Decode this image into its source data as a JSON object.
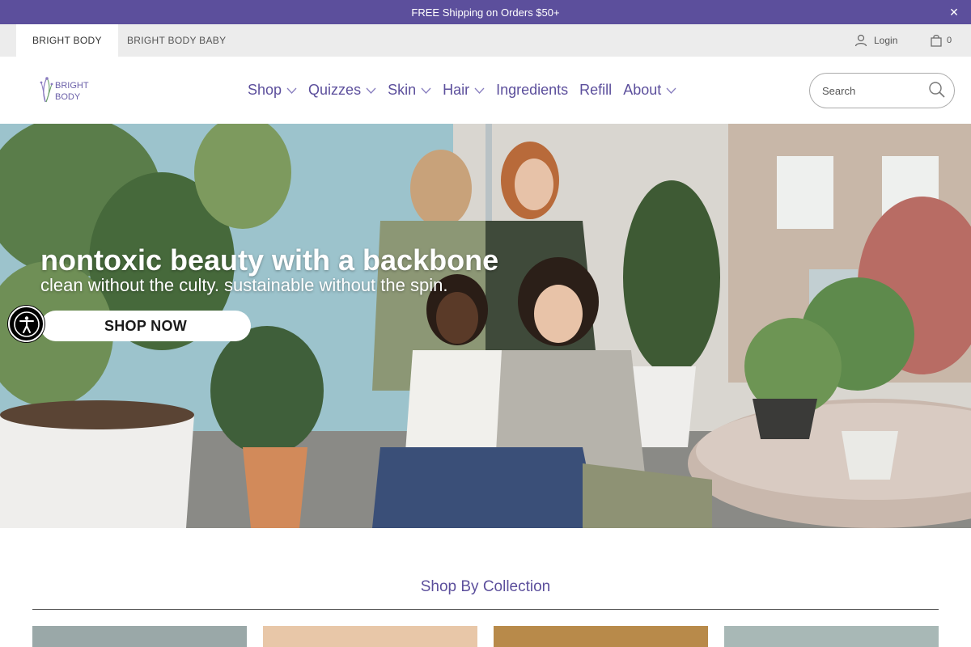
{
  "announcement": {
    "text": "FREE Shipping on Orders $50+",
    "close_icon": "close-icon",
    "bg": "#5c4f9c"
  },
  "store_switcher": {
    "tabs": [
      {
        "label": "BRIGHT BODY",
        "active": true
      },
      {
        "label": "BRIGHT BODY BABY",
        "active": false
      }
    ],
    "login_label": "Login",
    "cart_count": "0"
  },
  "header": {
    "logo_text_1": "BRIGHT",
    "logo_text_2": "BODY",
    "nav": [
      {
        "label": "Shop",
        "dropdown": true
      },
      {
        "label": "Quizzes",
        "dropdown": true
      },
      {
        "label": "Skin",
        "dropdown": true
      },
      {
        "label": "Hair",
        "dropdown": true
      },
      {
        "label": "Ingredients",
        "dropdown": false
      },
      {
        "label": "Refill",
        "dropdown": false
      },
      {
        "label": "About",
        "dropdown": true
      }
    ],
    "search_placeholder": "Search",
    "accent": "#5c4f9c"
  },
  "hero": {
    "title": "nontoxic beauty with a backbone",
    "subtitle": "clean without the culty. sustainable without the spin.",
    "cta": "SHOP NOW"
  },
  "collection": {
    "title": "Shop By Collection"
  }
}
